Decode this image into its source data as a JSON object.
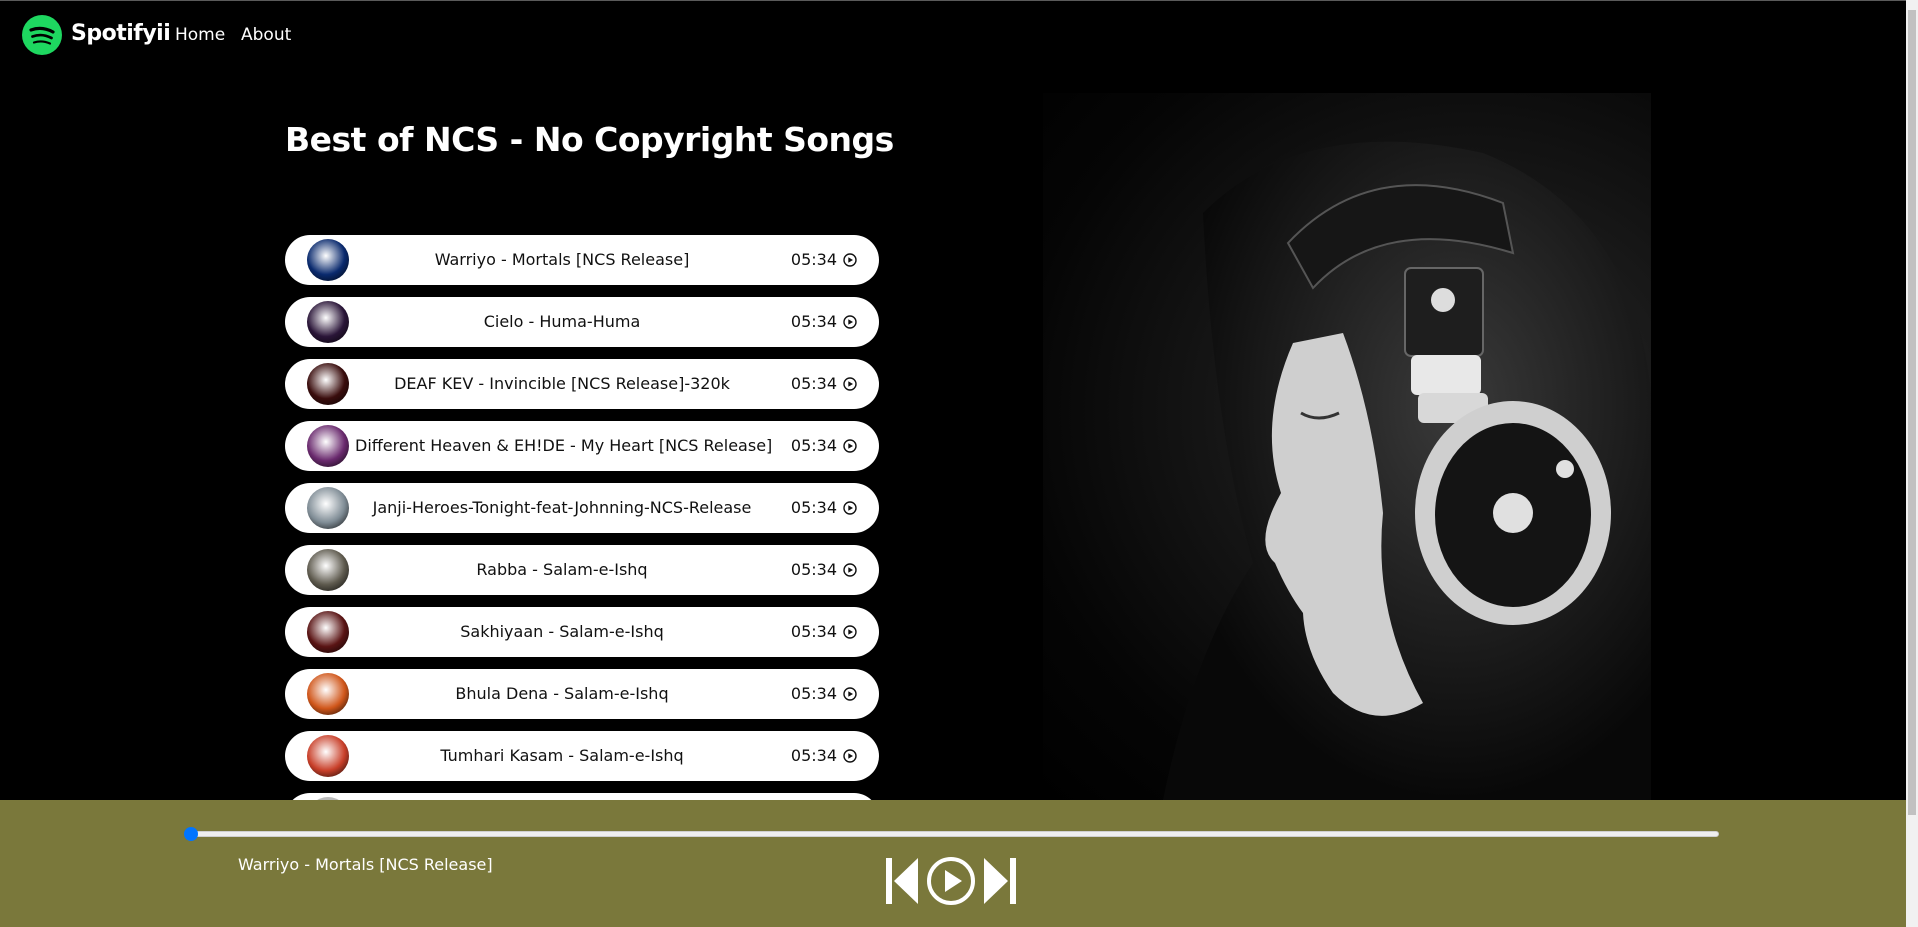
{
  "brand": {
    "name": "Spotifyii",
    "logo_icon": "spotify-logo-icon",
    "logo_color": "#1ed760"
  },
  "nav": {
    "home": "Home",
    "about": "About"
  },
  "page_title": "Best of NCS - No Copyright Songs",
  "songs": [
    {
      "name": "Warriyo - Mortals [NCS Release]",
      "time": "05:34",
      "cover_color": "#0a2a6e"
    },
    {
      "name": "Cielo - Huma-Huma",
      "time": "05:34",
      "cover_color": "#2a1538"
    },
    {
      "name": "DEAF KEV - Invincible [NCS Release]-320k",
      "time": "05:34",
      "cover_color": "#3a0d0d"
    },
    {
      "name": "Different Heaven & EH!DE - My Heart [NCS Release]",
      "time": "05:34",
      "cover_color": "#6a2a6e"
    },
    {
      "name": "Janji-Heroes-Tonight-feat-Johnning-NCS-Release",
      "time": "05:34",
      "cover_color": "#7f8c95"
    },
    {
      "name": "Rabba - Salam-e-Ishq",
      "time": "05:34",
      "cover_color": "#5e5a4e"
    },
    {
      "name": "Sakhiyaan - Salam-e-Ishq",
      "time": "05:34",
      "cover_color": "#5a1414"
    },
    {
      "name": "Bhula Dena - Salam-e-Ishq",
      "time": "05:34",
      "cover_color": "#d0561a"
    },
    {
      "name": "Tumhari Kasam - Salam-e-Ishq",
      "time": "05:34",
      "cover_color": "#c9402a"
    }
  ],
  "player": {
    "now_playing": "Warriyo - Mortals [NCS Release]",
    "progress": 0,
    "progress_thumb_color": "#0075ff",
    "background_color": "#7a783b",
    "controls": {
      "previous_icon": "previous-icon",
      "play_icon": "play-circle-icon",
      "next_icon": "next-icon"
    }
  },
  "hero_image": "woman-with-headphones-photo"
}
